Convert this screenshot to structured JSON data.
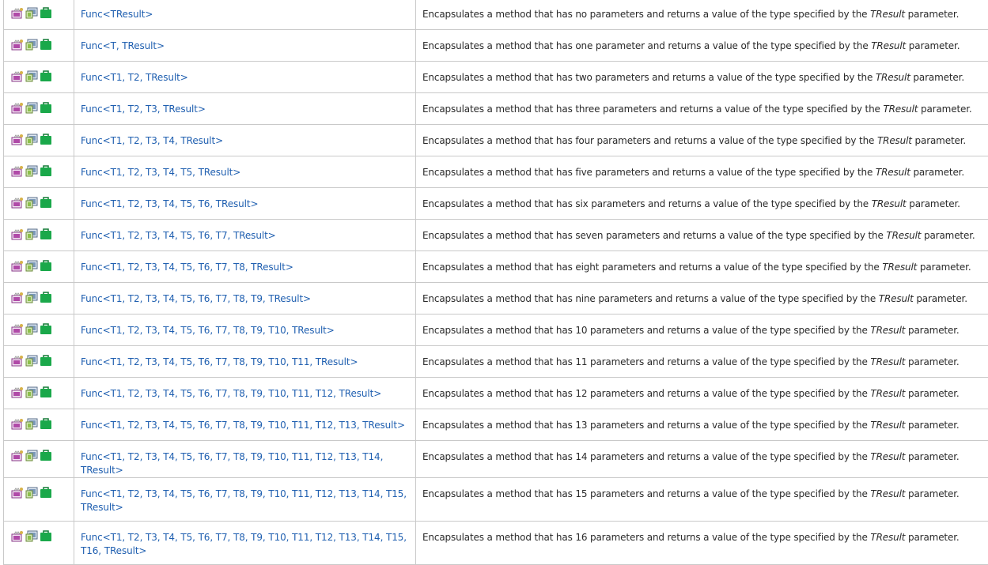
{
  "rows": [
    {
      "name": "Func<TResult>",
      "desc_prefix": "Encapsulates a method that has no parameters and returns a value of the type specified by the ",
      "desc_param": "TResult",
      "desc_suffix": " parameter."
    },
    {
      "name": "Func<T, TResult>",
      "desc_prefix": "Encapsulates a method that has one parameter and returns a value of the type specified by the ",
      "desc_param": "TResult",
      "desc_suffix": " parameter."
    },
    {
      "name": "Func<T1, T2, TResult>",
      "desc_prefix": "Encapsulates a method that has two parameters and returns a value of the type specified by the ",
      "desc_param": "TResult",
      "desc_suffix": " parameter."
    },
    {
      "name": "Func<T1, T2, T3, TResult>",
      "desc_prefix": "Encapsulates a method that has three parameters and returns a value of the type specified by the ",
      "desc_param": "TResult",
      "desc_suffix": " parameter."
    },
    {
      "name": "Func<T1, T2, T3, T4, TResult>",
      "desc_prefix": "Encapsulates a method that has four parameters and returns a value of the type specified by the ",
      "desc_param": "TResult",
      "desc_suffix": " parameter."
    },
    {
      "name": "Func<T1, T2, T3, T4, T5, TResult>",
      "desc_prefix": "Encapsulates a method that has five parameters and returns a value of the type specified by the ",
      "desc_param": "TResult",
      "desc_suffix": " parameter."
    },
    {
      "name": "Func<T1, T2, T3, T4, T5, T6, TResult>",
      "desc_prefix": "Encapsulates a method that has six parameters and returns a value of the type specified by the ",
      "desc_param": "TResult",
      "desc_suffix": " parameter."
    },
    {
      "name": "Func<T1, T2, T3, T4, T5, T6, T7, TResult>",
      "desc_prefix": "Encapsulates a method that has seven parameters and returns a value of the type specified by the ",
      "desc_param": "TResult",
      "desc_suffix": " parameter."
    },
    {
      "name": "Func<T1, T2, T3, T4, T5, T6, T7, T8, TResult>",
      "desc_prefix": "Encapsulates a method that has eight parameters and returns a value of the type specified by the ",
      "desc_param": "TResult",
      "desc_suffix": " parameter."
    },
    {
      "name": "Func<T1, T2, T3, T4, T5, T6, T7, T8, T9, TResult>",
      "desc_prefix": "Encapsulates a method that has nine parameters and returns a value of the type specified by the ",
      "desc_param": "TResult",
      "desc_suffix": " parameter."
    },
    {
      "name": "Func<T1, T2, T3, T4, T5, T6, T7, T8, T9, T10, TResult>",
      "desc_prefix": "Encapsulates a method that has 10 parameters and returns a value of the type specified by the ",
      "desc_param": "TResult",
      "desc_suffix": " parameter."
    },
    {
      "name": "Func<T1, T2, T3, T4, T5, T6, T7, T8, T9, T10, T11, TResult>",
      "desc_prefix": "Encapsulates a method that has 11 parameters and returns a value of the type specified by the ",
      "desc_param": "TResult",
      "desc_suffix": " parameter."
    },
    {
      "name": "Func<T1, T2, T3, T4, T5, T6, T7, T8, T9, T10, T11, T12, TResult>",
      "desc_prefix": "Encapsulates a method that has 12 parameters and returns a value of the type specified by the ",
      "desc_param": "TResult",
      "desc_suffix": " parameter."
    },
    {
      "name": "Func<T1, T2, T3, T4, T5, T6, T7, T8, T9, T10, T11, T12, T13, TResult>",
      "desc_prefix": "Encapsulates a method that has 13 parameters and returns a value of the type specified by the ",
      "desc_param": "TResult",
      "desc_suffix": " parameter."
    },
    {
      "name": "Func<T1, T2, T3, T4, T5, T6, T7, T8, T9, T10, T11, T12, T13, T14, TResult>",
      "desc_prefix": "Encapsulates a method that has 14 parameters and returns a value of the type specified by the ",
      "desc_param": "TResult",
      "desc_suffix": " parameter."
    },
    {
      "name": "Func<T1, T2, T3, T4, T5, T6, T7, T8, T9, T10, T11, T12, T13, T14, T15, TResult>",
      "desc_prefix": "Encapsulates a method that has 15 parameters and returns a value of the type specified by the ",
      "desc_param": "TResult",
      "desc_suffix": " parameter."
    },
    {
      "name": "Func<T1, T2, T3, T4, T5, T6, T7, T8, T9, T10, T11, T12, T13, T14, T15, T16, TResult>",
      "desc_prefix": "Encapsulates a method that has 16 parameters and returns a value of the type specified by the ",
      "desc_param": "TResult",
      "desc_suffix": " parameter."
    }
  ],
  "icons": [
    "public-delegate-icon",
    "xna-framework-icon",
    "portable-class-library-icon"
  ],
  "colors": {
    "link": "#1f5fb0",
    "text": "#2a2a2a",
    "border": "#c9c9c9",
    "green_icon": "#1aa84a",
    "purple_icon": "#b04aa8"
  }
}
